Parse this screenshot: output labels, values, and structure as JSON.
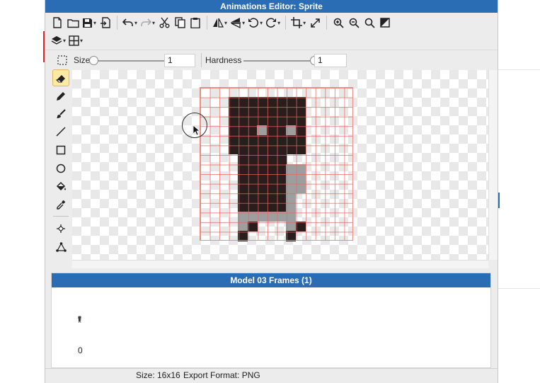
{
  "window": {
    "title": "Animations Editor: Sprite"
  },
  "options": {
    "size_label": "Size",
    "size_value": "1",
    "size_slider_fraction": 0.0,
    "hardness_label": "Hardness",
    "hardness_value": "1",
    "hardness_slider_fraction": 1.0
  },
  "toolbar": {
    "row1": [
      "new-file",
      "open",
      "save",
      "export",
      "undo",
      "redo",
      "cut",
      "copy",
      "paste",
      "flip-horizontal",
      "flip-vertical",
      "rotate-left",
      "rotate-right",
      "crop",
      "resize",
      "zoom-in",
      "zoom-out",
      "zoom-actual",
      "toggle-background"
    ],
    "row2": [
      "layers",
      "grid"
    ]
  },
  "tools": [
    "eraser",
    "pencil",
    "brush",
    "line",
    "rectangle",
    "ellipse",
    "fill",
    "eyedropper",
    "move-point",
    "skeleton"
  ],
  "active_tool": "eraser",
  "sprite": {
    "width": 16,
    "height": 16,
    "colors": {
      "dark": "#2b1d1c",
      "gray": "#9e9e9e",
      "grid": "#ec645f"
    },
    "rows": [
      "................",
      "...DDDDDDDD.....",
      "...DDDDDDDD.....",
      "...DDDDDDDD.....",
      "...DDDGDDGD.....",
      "...DDDDDDDD.....",
      "...DDDDDDDD.....",
      "....DDDDD.......",
      "....DDDDDGG.....",
      "....DDDDDGG.....",
      "....DDDDDGG.....",
      "....DDDDDG......",
      "....DDDDDG......",
      "....GGGGGG......",
      "....GD...GD.....",
      "....D....D......"
    ]
  },
  "frames_panel": {
    "title": "Model 03 Frames (1)",
    "frames": [
      {
        "index": "0"
      }
    ]
  },
  "status": {
    "size": "Size: 16x16",
    "export_format": "Export Format: PNG"
  },
  "colors": {
    "accent": "#2a6db4",
    "active_tool_bg": "#fde9a6"
  }
}
